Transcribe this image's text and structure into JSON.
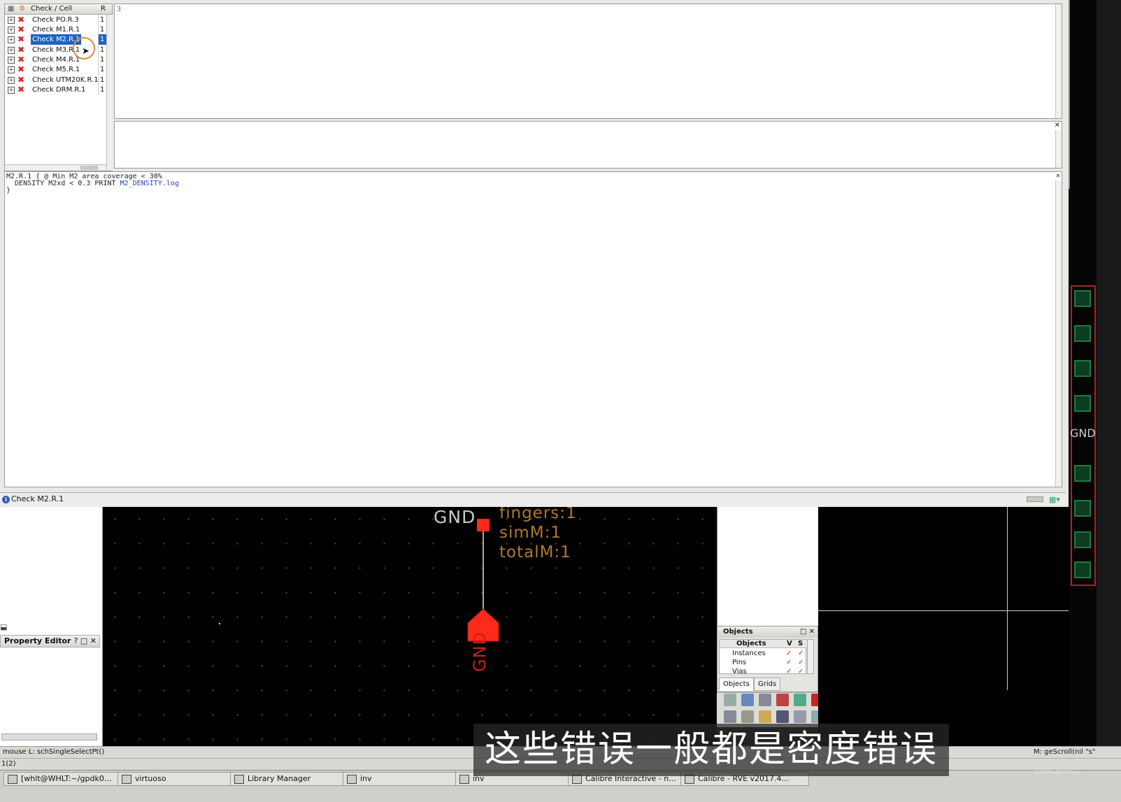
{
  "rve": {
    "tree_header": {
      "check_cell": "Check / Cell",
      "r": "R"
    },
    "checks": [
      {
        "label": "Check PO.R.3",
        "count": "1",
        "selected": false
      },
      {
        "label": "Check M1.R.1",
        "count": "1",
        "selected": false
      },
      {
        "label": "Check M2.R.1",
        "count": "1",
        "selected": true
      },
      {
        "label": "Check M3.R.1",
        "count": "1",
        "selected": false
      },
      {
        "label": "Check M4.R.1",
        "count": "1",
        "selected": false
      },
      {
        "label": "Check M5.R.1",
        "count": "1",
        "selected": false
      },
      {
        "label": "Check UTM20K.R.1",
        "count": "1",
        "selected": false
      },
      {
        "label": "Check DRM.R.1",
        "count": "1",
        "selected": false
      }
    ],
    "results_count": "3",
    "rule_text": {
      "line1": "M2.R.1 { @ Min M2 area coverage < 30%",
      "line2_prefix": "  DENSITY M2xd < 0.3 PRINT ",
      "line2_link": "M2_DENSITY.log",
      "line3": "}"
    },
    "status": "Check M2.R.1"
  },
  "virtuoso": {
    "schematic": {
      "pin_label": "GND",
      "instance_props": [
        "fingers:1",
        "simM:1",
        "totalM:1"
      ],
      "gnd_symbol_label": "GND",
      "right_label": "GND"
    },
    "property_editor_title": "Property Editor",
    "objects_panel": {
      "title": "Objects",
      "columns": [
        "Objects",
        "V",
        "S"
      ],
      "rows": [
        "Instances",
        "Pins",
        "Vias"
      ],
      "tabs": [
        "Objects",
        "Grids"
      ]
    },
    "mouse_status": "mouse L: schSingleSelectPt()",
    "line_status": "1(2)",
    "mouse_right": "M: geScroll(nil \"s\""
  },
  "taskbar": [
    "[whlt@WHLT:~/gpdk0...",
    "virtuoso",
    "Library Manager",
    "inv",
    "inv",
    "Calibre Interactive - n...",
    "Calibre - RVE v2017.4..."
  ],
  "subtitle": "这些错误一般都是密度错误",
  "watermark": "CSDN @WTaya",
  "colors": {
    "selection": "#1f62c4",
    "error_marker": "#dd2222",
    "schematic_red": "#ff2a1a",
    "schematic_label": "#b07a2a"
  }
}
